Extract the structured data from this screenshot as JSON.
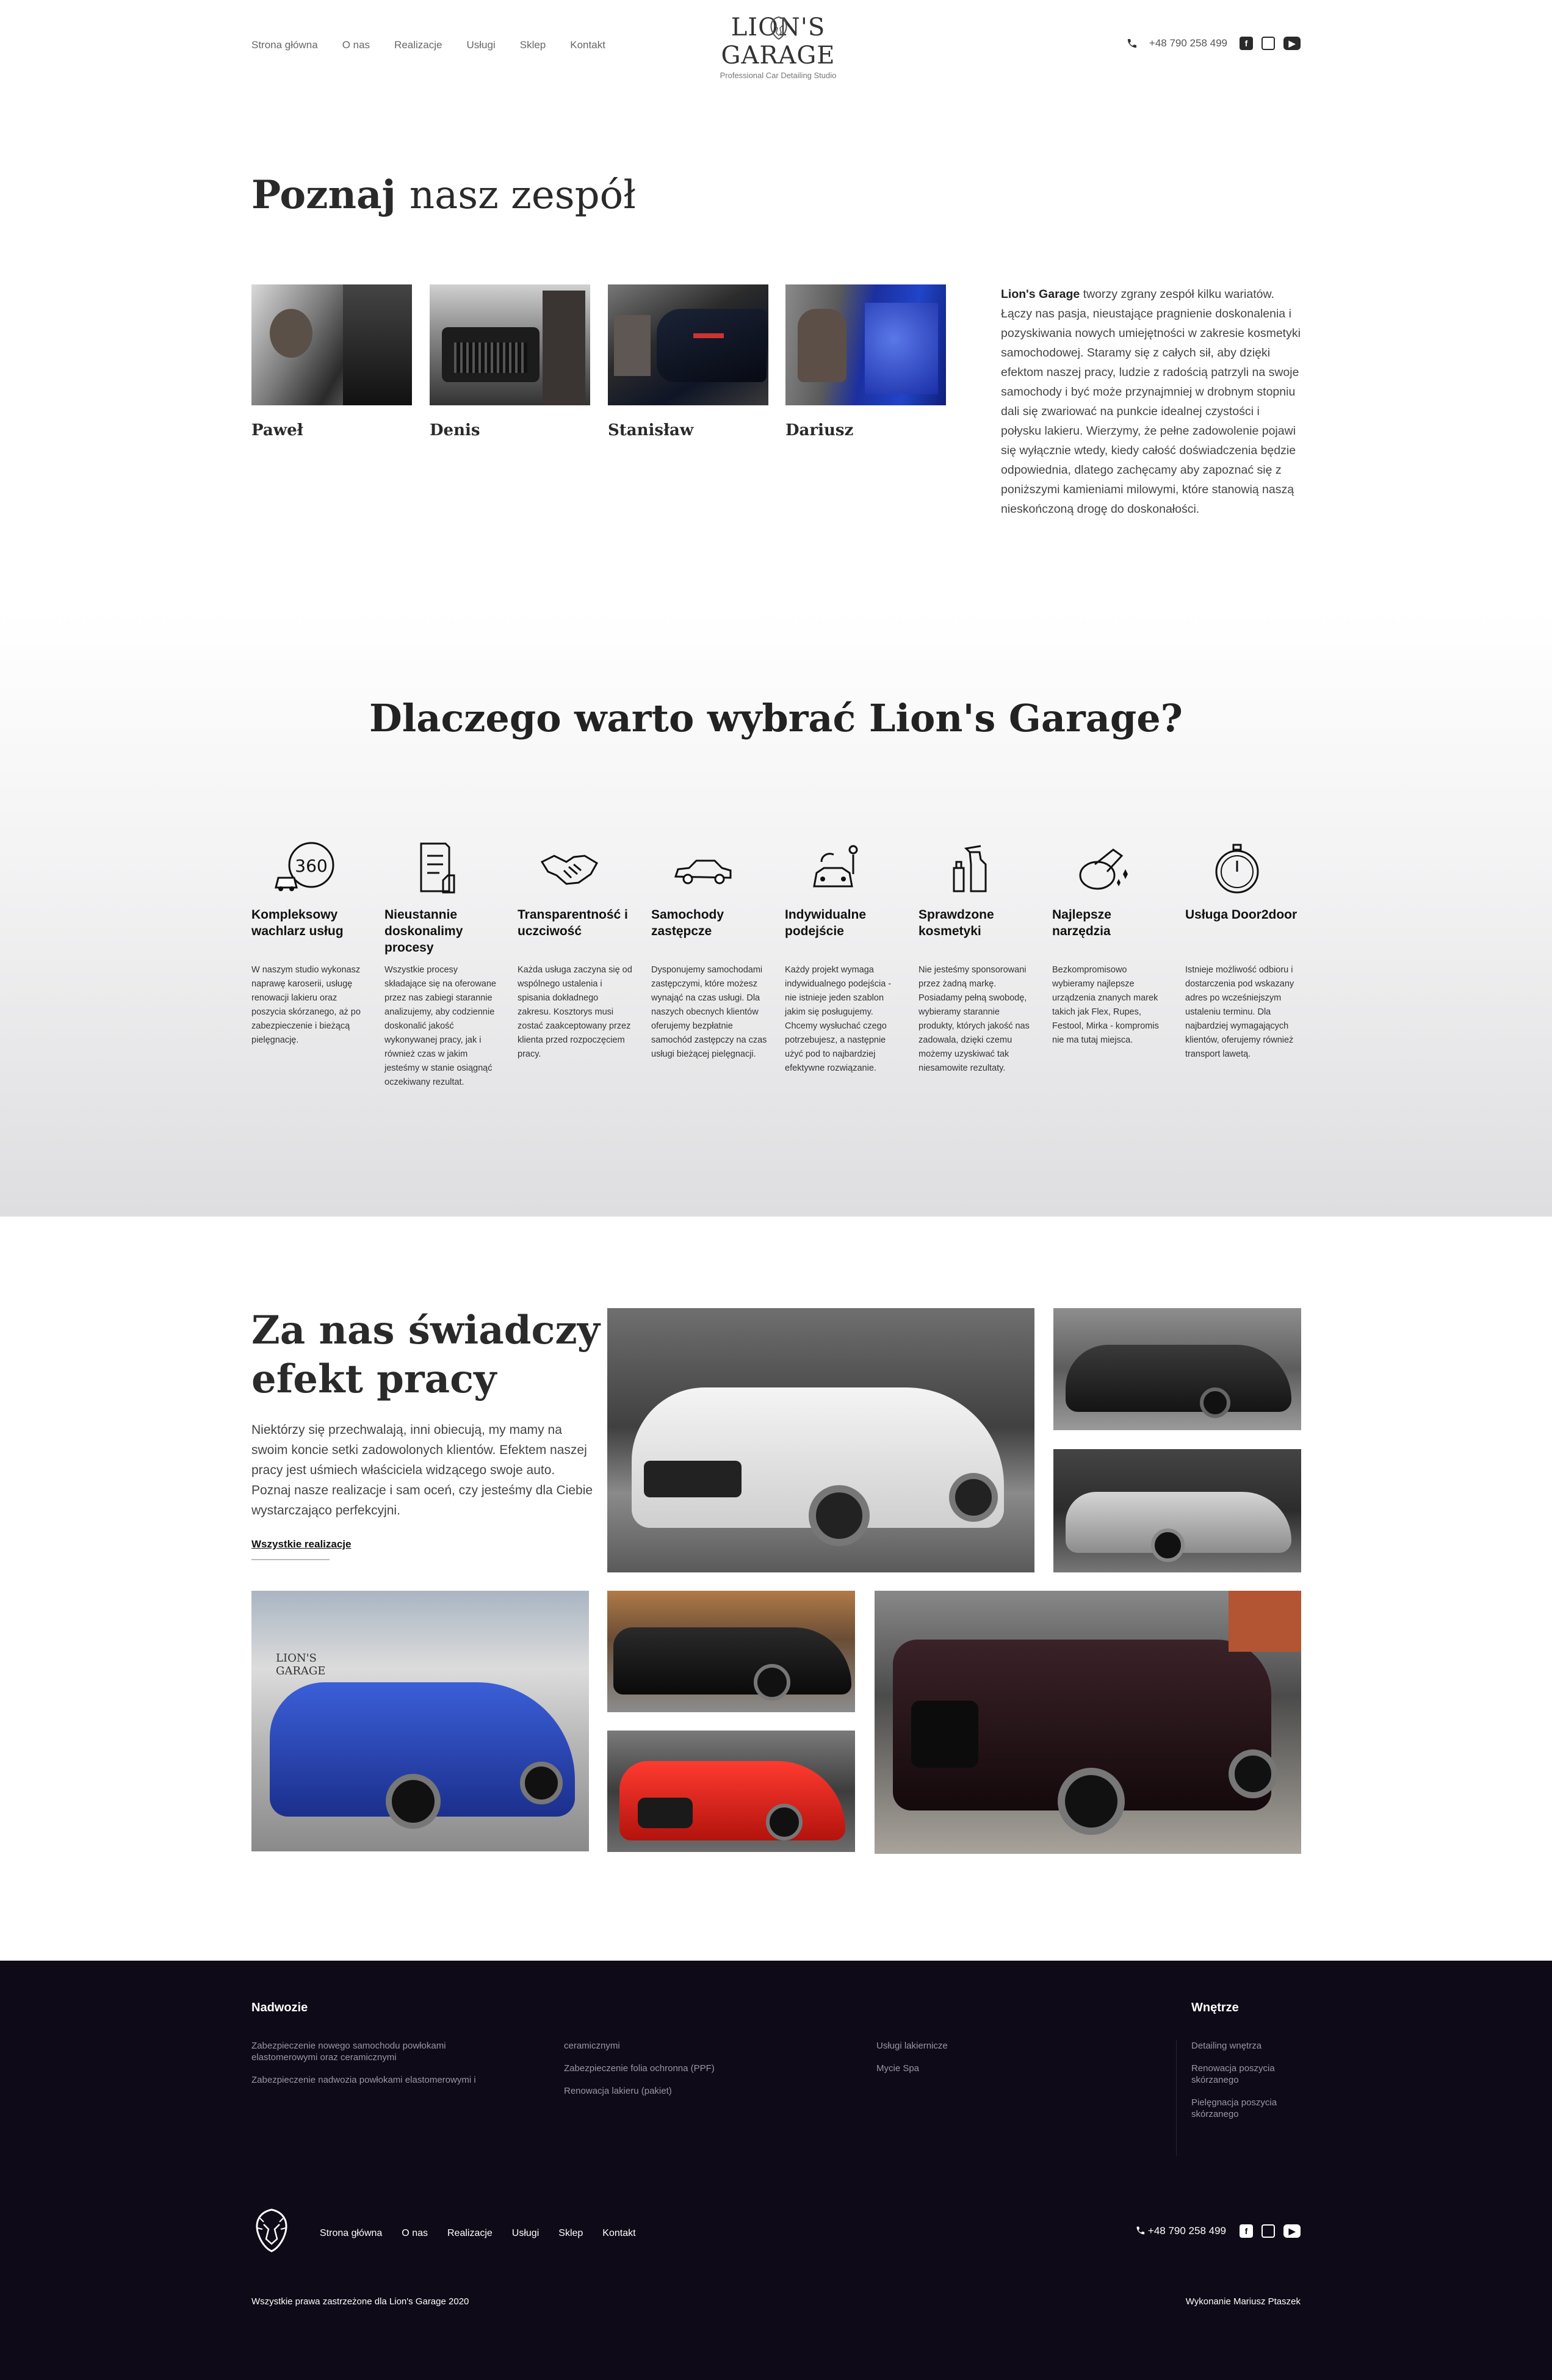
{
  "header": {
    "nav": [
      "Strona główna",
      "O nas",
      "Realizacje",
      "Usługi",
      "Sklep",
      "Kontakt"
    ],
    "logo_title": "LION'S GARAGE",
    "logo_subtitle": "Professional Car Detailing Studio",
    "phone": "+48 790 258 499",
    "social": [
      "facebook-icon",
      "instagram-icon",
      "youtube-icon"
    ]
  },
  "team": {
    "title_bold": "Poznaj",
    "title_rest": "nasz zespół",
    "members": [
      {
        "name": "Paweł"
      },
      {
        "name": "Denis"
      },
      {
        "name": "Stanisław"
      },
      {
        "name": "Dariusz"
      }
    ],
    "intro_bold": "Lion's Garage",
    "intro_text": " tworzy zgrany zespół kilku wariatów. Łączy nas pasja, nieustające pragnienie doskonalenia i pozyskiwania nowych umiejętności w zakresie kosmetyki samochodowej. Staramy się z całych sił, aby dzięki efektom naszej pracy, ludzie z radością patrzyli na swoje samochody i być może przynajmniej w drobnym stopniu dali się zwariować na punkcie idealnej czystości i połysku lakieru. Wierzymy, że pełne zadowolenie pojawi się wyłącznie wtedy, kiedy całość doświadczenia będzie odpowiednia, dlatego zachęcamy aby zapoznać się z poniższymi kamieniami milowymi, które stanowią naszą nieskończoną drogę do doskonałości."
  },
  "why": {
    "title_rest": "Dlaczego warto wybrać ",
    "title_bold": "Lion's Garage?",
    "features": [
      {
        "icon": "360-car-icon",
        "title": "Kompleksowy wachlarz usług",
        "desc": "W naszym studio wykonasz naprawę karoserii, usługę renowacji lakieru oraz poszycia skórzanego, aż po zabezpieczenie i bieżącą pielęgnację."
      },
      {
        "icon": "checklist-icon",
        "title": "Nieustannie doskonalimy procesy",
        "desc": "Wszystkie procesy składające się na oferowane przez nas zabiegi starannie analizujemy, aby codziennie doskonalić jakość wykonywanej pracy, jak i również czas w jakim jesteśmy w stanie osiągnąć oczekiwany rezultat."
      },
      {
        "icon": "handshake-icon",
        "title": "Transparentność i uczciwość",
        "desc": "Każda usługa zaczyna się od wspólnego ustalenia i spisania dokładnego zakresu. Kosztorys musi zostać zaakceptowany przez klienta przed rozpoczęciem pracy."
      },
      {
        "icon": "car-icon",
        "title": "Samochody zastępcze",
        "desc": "Dysponujemy samochodami zastępczymi, które możesz wynająć na czas usługi. Dla naszych obecnych klientów oferujemy bezpłatnie samochód zastępczy na czas usługi bieżącej pielęgnacji."
      },
      {
        "icon": "car-wash-icon",
        "title": "Indywidualne podejście",
        "desc": "Każdy projekt wymaga indywidualnego podejścia - nie istnieje jeden szablon jakim się posługujemy. Chcemy wysłuchać czego potrzebujesz, a następnie użyć pod to najbardziej efektywne rozwiązanie."
      },
      {
        "icon": "spray-bottle-icon",
        "title": "Sprawdzone kosmetyki",
        "desc": "Nie jesteśmy sponsorowani przez żadną markę. Posiadamy pełną swobodę, wybieramy starannie produkty, których jakość nas zadowala, dzięki czemu możemy uzyskiwać tak niesamowite rezultaty."
      },
      {
        "icon": "polisher-icon",
        "title": "Najlepsze narzędzia",
        "desc": "Bezkompromisowo wybieramy najlepsze urządzenia znanych marek takich jak Flex, Rupes, Festool, Mirka - kompromis nie ma tutaj miejsca."
      },
      {
        "icon": "stopwatch-icon",
        "title": "Usługa Door2door",
        "desc": "Istnieje możliwość odbioru i dostarczenia pod wskazany adres po wcześniejszym ustaleniu terminu. Dla najbardziej wymagających klientów, oferujemy również transport lawetą."
      }
    ]
  },
  "realizations": {
    "title_bold": "Za nas świadczy",
    "title_rest": "efekt pracy",
    "text": "Niektórzy się przechwalają, inni obiecują, my mamy na swoim koncie setki zadowolonych klientów. Efektem naszej pracy jest uśmiech właściciela widzącego swoje auto. Poznaj nasze realizacje i sam oceń, czy jesteśmy dla Ciebie wystarczająco perfekcyjni.",
    "link": "Wszystkie realizacje"
  },
  "footer": {
    "col1_head": "Nadwozie",
    "col1": [
      "Zabezpieczenie nowego samochodu powłokami elastomerowymi oraz ceramicznymi",
      "Zabezpieczenie nadwozia powłokami elastomerowymi i"
    ],
    "col2": [
      "ceramicznymi",
      "Zabezpieczenie folia ochronna (PPF)",
      "Renowacja lakieru (pakiet)"
    ],
    "col3": [
      "Usługi lakiernicze",
      "Mycie Spa"
    ],
    "col4_head": "Wnętrze",
    "col4": [
      "Detailing wnętrza",
      "Renowacja poszycia skórzanego",
      "Pielęgnacja poszycia skórzanego"
    ],
    "nav": [
      "Strona główna",
      "O nas",
      "Realizacje",
      "Usługi",
      "Sklep",
      "Kontakt"
    ],
    "phone": "+48 790 258 499",
    "copyright": "Wszystkie prawa zastrzeżone dla Lion's Garage 2020",
    "credit": "Wykonanie Mariusz Ptaszek"
  }
}
